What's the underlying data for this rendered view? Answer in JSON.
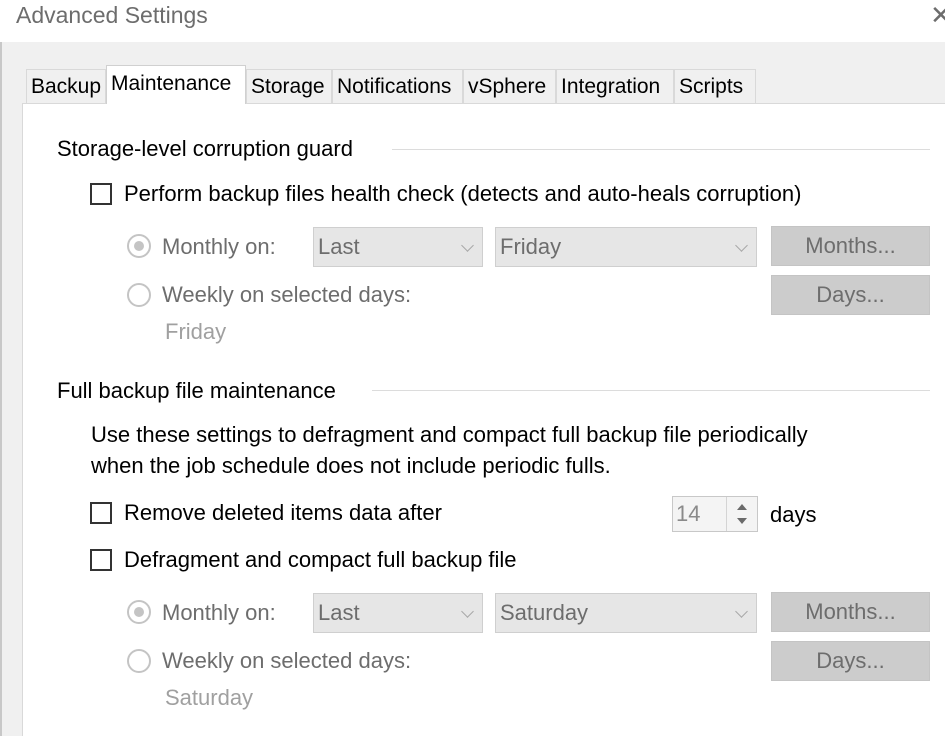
{
  "window": {
    "title": "Advanced Settings"
  },
  "tabs": [
    {
      "label": "Backup"
    },
    {
      "label": "Maintenance"
    },
    {
      "label": "Storage"
    },
    {
      "label": "Notifications"
    },
    {
      "label": "vSphere"
    },
    {
      "label": "Integration"
    },
    {
      "label": "Scripts"
    }
  ],
  "active_tab": "Maintenance",
  "corruption_guard": {
    "title": "Storage-level corruption guard",
    "health_check_label": "Perform backup files health check (detects and auto-heals corruption)",
    "health_check_checked": false,
    "monthly_label": "Monthly on:",
    "monthly_week": "Last",
    "monthly_day": "Friday",
    "months_button": "Months...",
    "weekly_label": "Weekly on selected days:",
    "days_button": "Days...",
    "weekly_days": "Friday",
    "selected_mode": "monthly"
  },
  "full_maintenance": {
    "title": "Full backup file maintenance",
    "description_line1": "Use these settings to defragment and compact full backup file periodically",
    "description_line2": "when the job schedule does not include periodic fulls.",
    "remove_label": "Remove deleted items data after",
    "remove_checked": false,
    "remove_days": "14",
    "days_unit": "days",
    "defrag_label": "Defragment and compact full backup file",
    "defrag_checked": false,
    "monthly_label": "Monthly on:",
    "monthly_week": "Last",
    "monthly_day": "Saturday",
    "months_button": "Months...",
    "weekly_label": "Weekly on selected days:",
    "days_button": "Days...",
    "weekly_days": "Saturday",
    "selected_mode": "monthly"
  },
  "colors": {
    "panel_bg": "#ffffff",
    "window_bg": "#f0f0f0",
    "disabled_text": "#6d6d6d",
    "disabled_button": "#cccccc"
  }
}
